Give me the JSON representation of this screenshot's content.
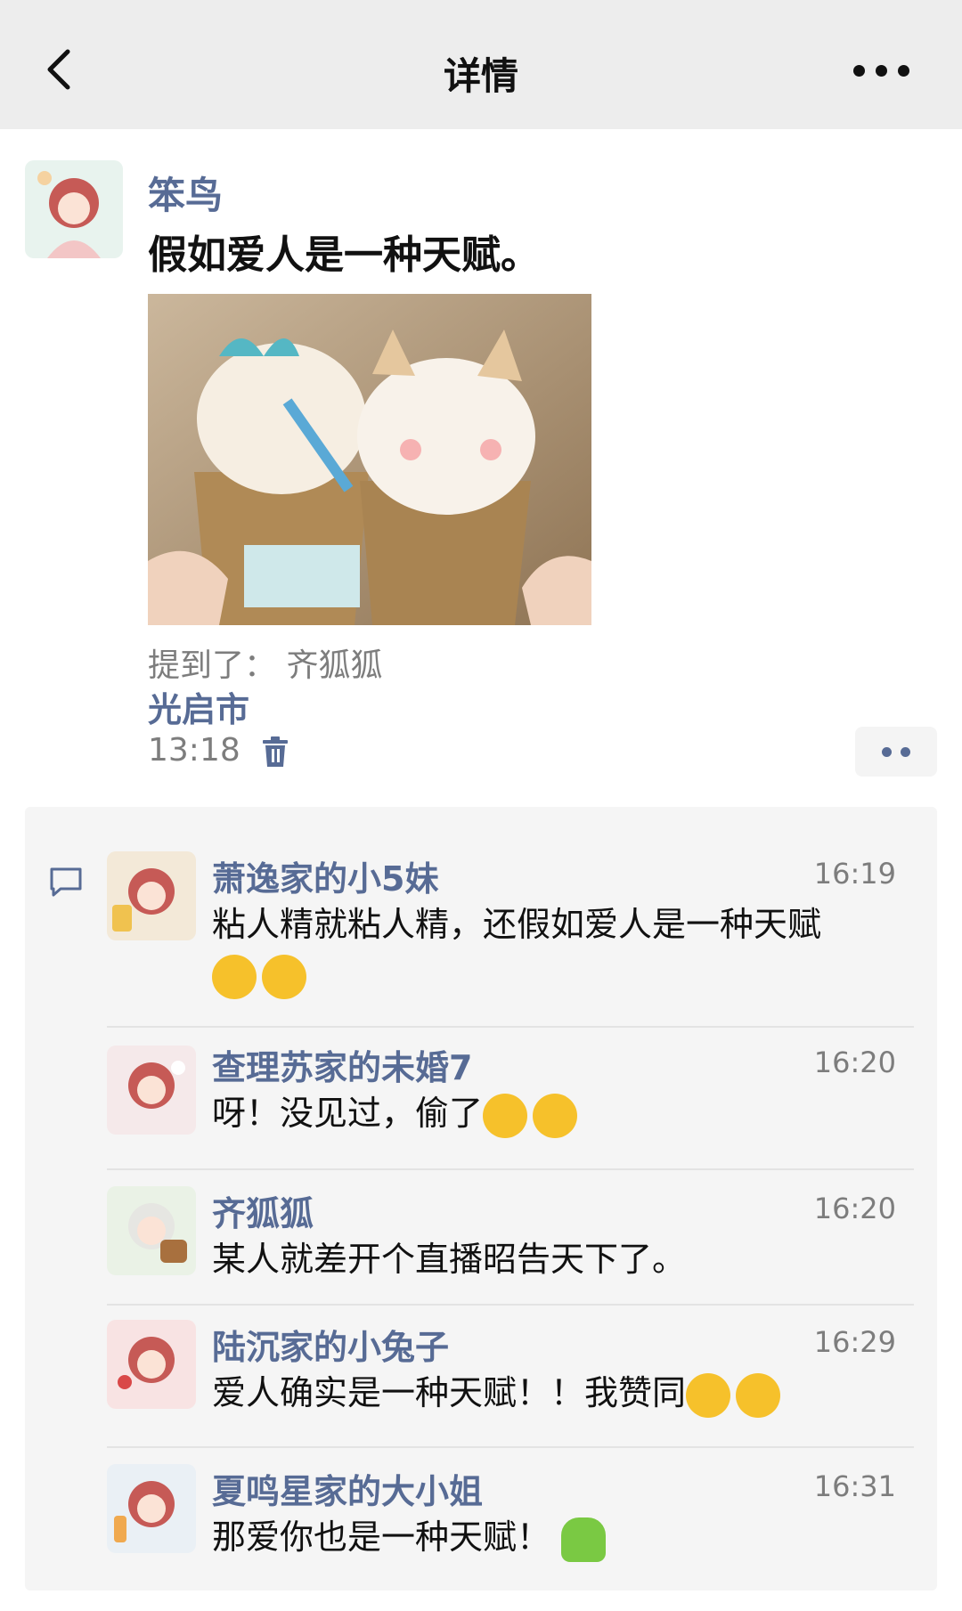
{
  "header": {
    "title": "详情"
  },
  "post": {
    "author": "笨鸟",
    "text": "假如爱人是一种天赋。",
    "mention": "提到了： 齐狐狐",
    "location": "光启市",
    "time": "13:18"
  },
  "comments": [
    {
      "name": "萧逸家的小5妹",
      "time": "16:19",
      "text": "粘人精就粘人精，还假如爱人是一种天赋"
    },
    {
      "name": "查理苏家的未婚7",
      "time": "16:20",
      "text": "呀！没见过，偷了"
    },
    {
      "name": "齐狐狐",
      "time": "16:20",
      "text": "某人就差开个直播昭告天下了。"
    },
    {
      "name": "陆沉家的小兔子",
      "time": "16:29",
      "text": "爱人确实是一种天赋！！我赞同"
    },
    {
      "name": "夏鸣星家的大小姐",
      "time": "16:31",
      "text": "那爱你也是一种天赋！"
    }
  ],
  "icons": {
    "back": "chevron-left-icon",
    "more": "more-dots-icon",
    "trash": "trash-icon",
    "comment": "comment-bubble-icon"
  },
  "colors": {
    "link": "#576b95",
    "header_bg": "#ededed",
    "comments_bg": "#f5f5f5"
  }
}
